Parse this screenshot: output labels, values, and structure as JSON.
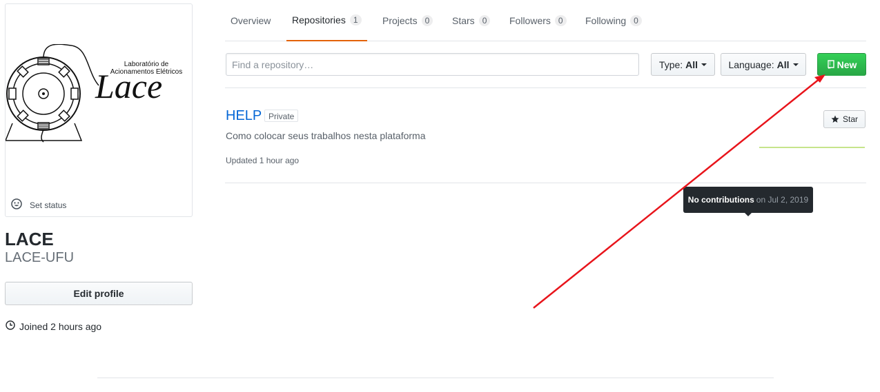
{
  "profile": {
    "logo_text_line1": "Laboratório de",
    "logo_text_line2": "Acionamentos Elétricos",
    "logo_wordmark": "Lace",
    "set_status_label": "Set status",
    "name": "LACE",
    "login": "LACE-UFU",
    "edit_profile_label": "Edit profile",
    "joined_text": "Joined 2 hours ago"
  },
  "tabs": [
    {
      "label": "Overview",
      "count": null,
      "selected": false
    },
    {
      "label": "Repositories",
      "count": "1",
      "selected": true
    },
    {
      "label": "Projects",
      "count": "0",
      "selected": false
    },
    {
      "label": "Stars",
      "count": "0",
      "selected": false
    },
    {
      "label": "Followers",
      "count": "0",
      "selected": false
    },
    {
      "label": "Following",
      "count": "0",
      "selected": false
    }
  ],
  "filters": {
    "search_placeholder": "Find a repository…",
    "type_label": "Type:",
    "type_value": "All",
    "language_label": "Language:",
    "language_value": "All",
    "new_label": "New"
  },
  "repo": {
    "name": "HELP",
    "visibility": "Private",
    "description": "Como colocar seus trabalhos nesta plataforma",
    "updated": "Updated 1 hour ago",
    "star_label": "Star"
  },
  "tooltip": {
    "strong": "No contributions",
    "date": "on Jul 2, 2019"
  },
  "colors": {
    "accent_green": "#28a745",
    "link_blue": "#0366d6",
    "tab_underline": "#e36209",
    "annotation_red": "#e8141b"
  },
  "icons": {
    "status": "smiley-icon",
    "joined": "clock-icon",
    "new": "repo-icon",
    "star": "star-icon"
  }
}
